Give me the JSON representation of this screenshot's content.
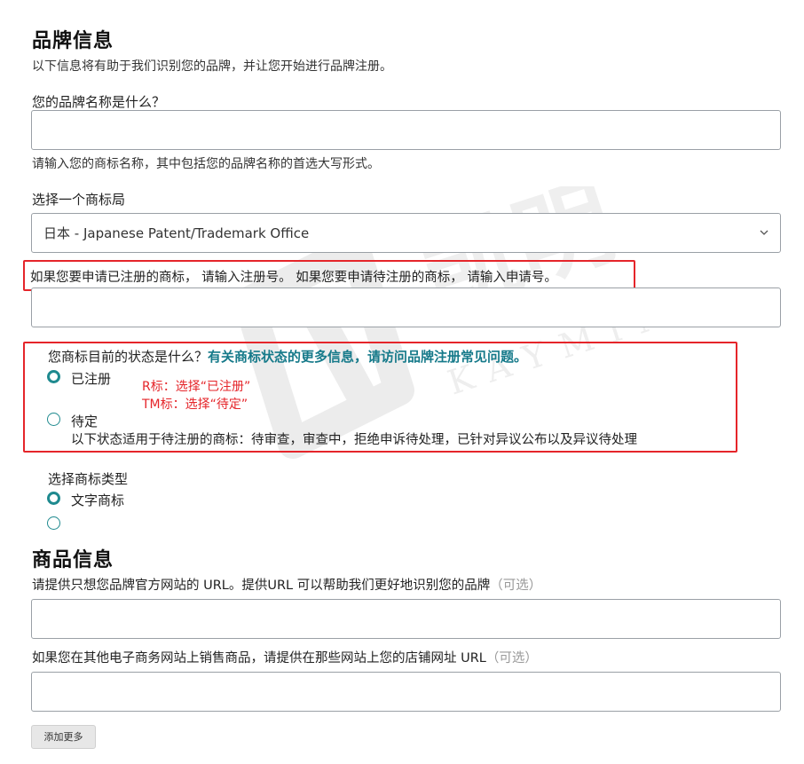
{
  "brand_section": {
    "title": "品牌信息",
    "subtitle": "以下信息将有助于我们识别您的品牌，并让您开始进行品牌注册。"
  },
  "brand_name": {
    "label": "您的品牌名称是什么？",
    "value": "",
    "hint": "请输入您的商标名称，其中包括您的品牌名称的首选大写形式。"
  },
  "trademark_office": {
    "label": "选择一个商标局",
    "selected": "日本 - Japanese Patent/Trademark Office"
  },
  "registration_number": {
    "label": "如果您要申请已注册的商标， 请输入注册号。 如果您要申请待注册的商标， 请输入申请号。",
    "value": ""
  },
  "trademark_status": {
    "question": "您商标目前的状态是什么？",
    "link": "有关商标状态的更多信息，请访问品牌注册常见问题。",
    "options": [
      {
        "label": "已注册",
        "selected": true
      },
      {
        "label": "待定",
        "selected": false,
        "description": "以下状态适用于待注册的商标：待审查，审查中，拒绝申诉待处理，已针对异议公布以及异议待处理"
      }
    ],
    "annotation_line1": "R标：选择“已注册”",
    "annotation_line2": "TM标：选择“待定”"
  },
  "trademark_type": {
    "label": "选择商标类型",
    "options": [
      {
        "label": "文字商标",
        "selected": true
      },
      {
        "label": "",
        "selected": false
      }
    ]
  },
  "product_section": {
    "title": "商品信息",
    "website_label": "请提供只想您品牌官方网站的 URL。提供URL 可以帮助我们更好地识别您的品牌",
    "website_optional": "（可选）",
    "website_value": "",
    "stores_label": "如果您在其他电子商务网站上销售商品，请提供在那些网站上您的店铺网址 URL",
    "stores_optional": "（可选）",
    "stores_value": "",
    "add_more_label": "添加更多"
  },
  "watermark": {
    "text_cn": "凯明",
    "text_en": "KAYMING"
  },
  "colors": {
    "annotation_red": "#e5252a",
    "accent_teal": "#1f8a8f",
    "link_teal": "#167a8a"
  }
}
